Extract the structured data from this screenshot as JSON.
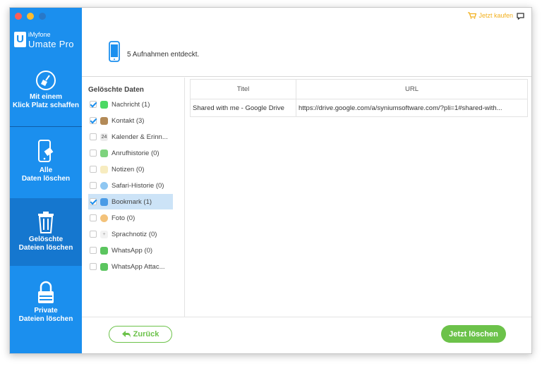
{
  "app": {
    "brand_small": "iMyfone",
    "brand_big": "Umate Pro",
    "logo_letter": "U"
  },
  "colors": {
    "sidebar": "#1b8fee",
    "sidebar_active": "#1577cf",
    "accent_green": "#6cc24a",
    "buy_orange": "#f2b01e"
  },
  "sidebar": {
    "items": [
      {
        "label": "Mit einem\nKlick Platz schaffen",
        "icon": "broom-icon",
        "active": false
      },
      {
        "label": "Alle\nDaten löschen",
        "icon": "phone-eraser-icon",
        "active": false
      },
      {
        "label": "Gelöschte\nDateien löschen",
        "icon": "trash-icon",
        "active": true
      },
      {
        "label": "Private\nDateien löschen",
        "icon": "lock-icon",
        "active": false
      }
    ]
  },
  "header": {
    "buy_label": "Jetzt kaufen",
    "status_text": "5 Aufnahmen entdeckt."
  },
  "categories": {
    "title": "Gelöschte Daten",
    "items": [
      {
        "label": "Nachricht (1)",
        "checked": true,
        "icon": "message-icon"
      },
      {
        "label": "Kontakt (3)",
        "checked": true,
        "icon": "contacts-icon"
      },
      {
        "label": "Kalender & Erinn...",
        "checked": false,
        "icon": "calendar-icon",
        "icon_text": "24"
      },
      {
        "label": "Anrufhistorie (0)",
        "checked": false,
        "icon": "phone-call-icon"
      },
      {
        "label": "Notizen (0)",
        "checked": false,
        "icon": "notes-icon"
      },
      {
        "label": "Safari-Historie (0)",
        "checked": false,
        "icon": "safari-icon"
      },
      {
        "label": "Bookmark (1)",
        "checked": true,
        "icon": "bookmark-icon",
        "selected": true
      },
      {
        "label": "Foto (0)",
        "checked": false,
        "icon": "photos-icon"
      },
      {
        "label": "Sprachnotiz (0)",
        "checked": false,
        "icon": "voice-memo-icon"
      },
      {
        "label": "WhatsApp (0)",
        "checked": false,
        "icon": "whatsapp-icon"
      },
      {
        "label": "WhatsApp Attac...",
        "checked": false,
        "icon": "whatsapp-attachment-icon"
      }
    ]
  },
  "table": {
    "columns": [
      "Titel",
      "URL"
    ],
    "rows": [
      [
        "Shared with me - Google Drive",
        "https://drive.google.com/a/syniumsoftware.com/?pli=1#shared-with..."
      ]
    ]
  },
  "footer": {
    "back_label": "Zurück",
    "delete_label": "Jetzt löschen"
  }
}
